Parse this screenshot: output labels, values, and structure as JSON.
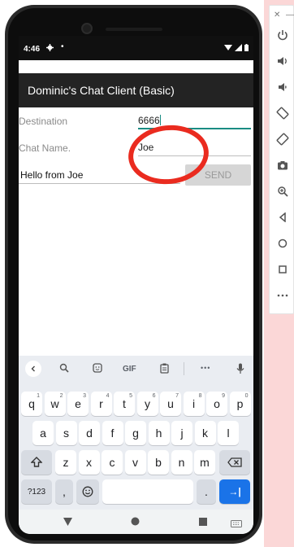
{
  "toolbar": {
    "minimize": "—",
    "close": "✕"
  },
  "status_bar": {
    "time": "4:46"
  },
  "app": {
    "title": "Dominic's Chat Client (Basic)"
  },
  "form": {
    "destination_label": "Destination",
    "destination_value": "6666",
    "chat_name_label": "Chat Name.",
    "chat_name_value": "Joe",
    "message_value": "Hello from Joe",
    "send_label": "SEND"
  },
  "keyboard": {
    "toolbar": {
      "gif_label": "GIF",
      "more_label": "•••"
    },
    "row1": [
      {
        "k": "q",
        "h": "1"
      },
      {
        "k": "w",
        "h": "2"
      },
      {
        "k": "e",
        "h": "3"
      },
      {
        "k": "r",
        "h": "4"
      },
      {
        "k": "t",
        "h": "5"
      },
      {
        "k": "y",
        "h": "6"
      },
      {
        "k": "u",
        "h": "7"
      },
      {
        "k": "i",
        "h": "8"
      },
      {
        "k": "o",
        "h": "9"
      },
      {
        "k": "p",
        "h": "0"
      }
    ],
    "row2": [
      "a",
      "s",
      "d",
      "f",
      "g",
      "h",
      "j",
      "k",
      "l"
    ],
    "row3": [
      "z",
      "x",
      "c",
      "v",
      "b",
      "n",
      "m"
    ],
    "symbols_label": "?123",
    "comma_label": ",",
    "period_label": ".",
    "enter_label": "→|"
  },
  "colors": {
    "accent": "#1a8c83",
    "annotation": "#ea2b1f",
    "keyboard_enter": "#1a73e8"
  },
  "icons": [
    "settings-gear-icon",
    "wifi-icon",
    "signal-icon",
    "battery-icon",
    "power-icon",
    "volume-up-icon",
    "volume-down-icon",
    "rotate-left-icon",
    "rotate-right-icon",
    "camera-icon",
    "zoom-icon",
    "back-icon",
    "home-icon",
    "overview-icon",
    "more-icon",
    "shift-icon",
    "backspace-icon",
    "emoji-icon",
    "mic-icon",
    "search-icon",
    "sticker-icon",
    "clipboard-icon"
  ]
}
